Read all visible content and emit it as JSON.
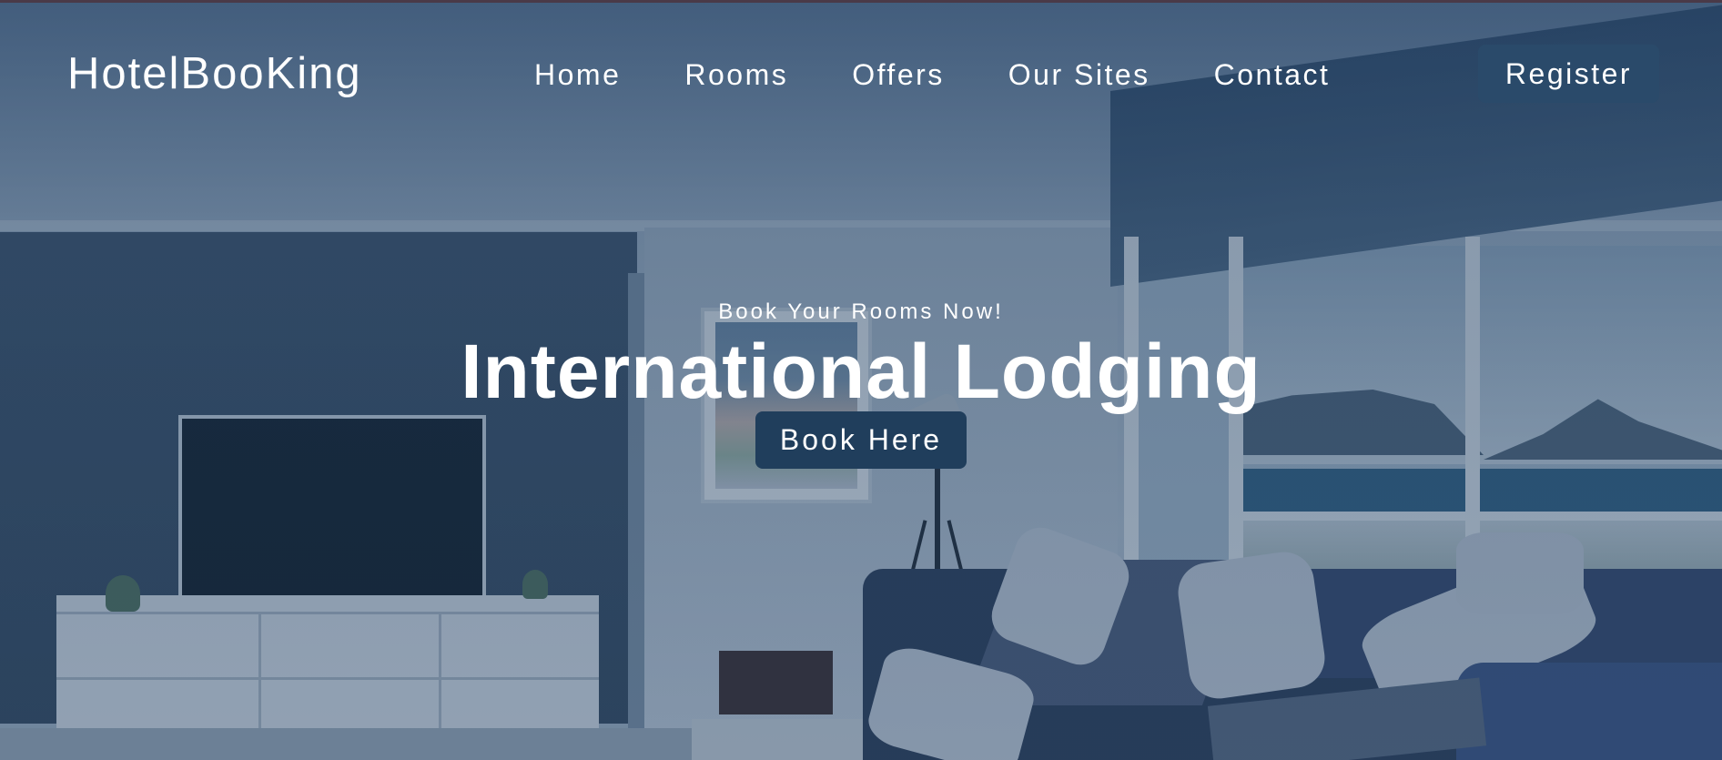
{
  "brand": {
    "name": "HotelBooKing"
  },
  "nav": {
    "items": [
      {
        "label": "Home"
      },
      {
        "label": "Rooms"
      },
      {
        "label": "Offers"
      },
      {
        "label": "Our Sites"
      },
      {
        "label": "Contact"
      }
    ],
    "register_label": "Register"
  },
  "hero": {
    "subtitle": "Book Your Rooms Now!",
    "title": "International Lodging",
    "cta_label": "Book Here",
    "background": "living-room-photo"
  },
  "colors": {
    "overlay": "#1d3a5e",
    "button": "#2a4a6a",
    "text": "#ffffff"
  }
}
